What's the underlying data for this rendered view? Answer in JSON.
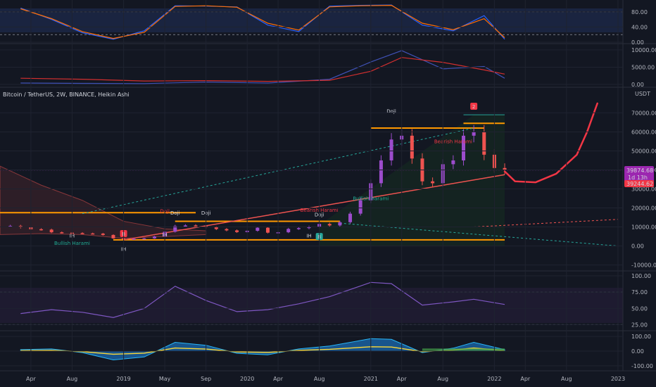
{
  "header": {
    "title": "Bitcoin / TetherUS, 2W, BINANCE, Heikin Ashi",
    "currency": "USDT"
  },
  "colors": {
    "background": "#131722",
    "grid": "#1f2330",
    "up": "#26a69a",
    "up_purple": "#9c4ccc",
    "down": "#ef5350",
    "orange": "#ff9800",
    "red_projection": "#f23645",
    "stoch_k": "#2962ff",
    "stoch_d": "#ff6d00",
    "rsi": "#7e57c2"
  },
  "x_axis": {
    "labels": [
      "Apr",
      "Aug",
      "2019",
      "May",
      "Sep",
      "2020",
      "Apr",
      "Aug",
      "2021",
      "Apr",
      "Aug",
      "2022",
      "Apr",
      "Aug",
      "2023"
    ]
  },
  "price_badges": {
    "current": "39874.68",
    "countdown": "1d 13h",
    "projection": "39244.62"
  },
  "chart_data": [
    {
      "type": "line",
      "panel": "stochastic",
      "ticks": [
        "80.00",
        "40.00",
        "0.00"
      ],
      "ylim": [
        0,
        100
      ],
      "x": [
        "2018-03",
        "2018-06",
        "2018-09",
        "2018-12",
        "2019-03",
        "2019-06",
        "2019-09",
        "2019-12",
        "2020-03",
        "2020-06",
        "2020-09",
        "2020-12",
        "2021-03",
        "2021-06",
        "2021-09",
        "2021-12",
        "2022-02"
      ],
      "series": [
        {
          "values": [
            90,
            60,
            25,
            8,
            30,
            96,
            95,
            93,
            45,
            28,
            95,
            97,
            98,
            45,
            30,
            70,
            8
          ]
        },
        {
          "values": [
            88,
            62,
            28,
            10,
            26,
            94,
            96,
            92,
            50,
            32,
            93,
            96,
            97,
            50,
            33,
            62,
            12
          ]
        }
      ]
    },
    {
      "type": "line",
      "panel": "oscillator",
      "ticks": [
        "10000.00",
        "5000.00",
        "0.00"
      ],
      "ylim": [
        0,
        11000
      ],
      "x": [
        "2018-03",
        "2018-09",
        "2019-03",
        "2019-09",
        "2020-03",
        "2020-09",
        "2021-01",
        "2021-04",
        "2021-08",
        "2021-12",
        "2022-02"
      ],
      "series": [
        {
          "values": [
            400,
            300,
            250,
            700,
            400,
            1500,
            6500,
            9800,
            4500,
            5200,
            1800
          ]
        },
        {
          "values": [
            1800,
            1500,
            1000,
            1100,
            900,
            1200,
            3800,
            7800,
            6400,
            4200,
            3000
          ]
        }
      ]
    },
    {
      "type": "candlestick",
      "panel": "price",
      "title": "Bitcoin / TetherUS, 2W, BINANCE, Heikin Ashi",
      "ticks": [
        "70000.00",
        "60000.00",
        "50000.00",
        "40000.00",
        "30000.00",
        "20000.00",
        "10000.00",
        "0.00",
        "-10000.00"
      ],
      "ylim": [
        -12000,
        82000
      ],
      "candles": [
        {
          "date": "2018-02",
          "value": 10500
        },
        {
          "date": "2018-03",
          "value": 9800
        },
        {
          "date": "2018-04",
          "value": 8800
        },
        {
          "date": "2018-05",
          "value": 8600
        },
        {
          "date": "2018-06",
          "value": 7200
        },
        {
          "date": "2018-07",
          "value": 7000
        },
        {
          "date": "2018-08",
          "value": 6800
        },
        {
          "date": "2018-09",
          "value": 6600
        },
        {
          "date": "2018-10",
          "value": 6500
        },
        {
          "date": "2018-11",
          "value": 5800
        },
        {
          "date": "2018-12",
          "value": 4000
        },
        {
          "date": "2019-01",
          "value": 3700
        },
        {
          "date": "2019-02",
          "value": 3800
        },
        {
          "date": "2019-03",
          "value": 4000
        },
        {
          "date": "2019-04",
          "value": 5000
        },
        {
          "date": "2019-05",
          "value": 7500
        },
        {
          "date": "2019-06",
          "value": 10500
        },
        {
          "date": "2019-07",
          "value": 10800
        },
        {
          "date": "2019-08",
          "value": 10500
        },
        {
          "date": "2019-09",
          "value": 9800
        },
        {
          "date": "2019-10",
          "value": 8900
        },
        {
          "date": "2019-11",
          "value": 8200
        },
        {
          "date": "2019-12",
          "value": 7300
        },
        {
          "date": "2020-01",
          "value": 8000
        },
        {
          "date": "2020-02",
          "value": 9600
        },
        {
          "date": "2020-03",
          "value": 7000
        },
        {
          "date": "2020-04",
          "value": 7200
        },
        {
          "date": "2020-05",
          "value": 9000
        },
        {
          "date": "2020-06",
          "value": 9400
        },
        {
          "date": "2020-07",
          "value": 10000
        },
        {
          "date": "2020-08",
          "value": 11600
        },
        {
          "date": "2020-09",
          "value": 10800
        },
        {
          "date": "2020-10",
          "value": 12500
        },
        {
          "date": "2020-11",
          "value": 17000
        },
        {
          "date": "2020-12",
          "value": 24000
        },
        {
          "date": "2021-01",
          "value": 33000
        },
        {
          "date": "2021-02",
          "value": 45000
        },
        {
          "date": "2021-03",
          "value": 56000
        },
        {
          "date": "2021-04",
          "value": 58000
        },
        {
          "date": "2021-05",
          "value": 46000
        },
        {
          "date": "2021-06",
          "value": 34000
        },
        {
          "date": "2021-07",
          "value": 33000
        },
        {
          "date": "2021-08",
          "value": 43000
        },
        {
          "date": "2021-09",
          "value": 45000
        },
        {
          "date": "2021-10",
          "value": 58000
        },
        {
          "date": "2021-11",
          "value": 60000
        },
        {
          "date": "2021-12",
          "value": 48000
        },
        {
          "date": "2022-01",
          "value": 41000
        },
        {
          "date": "2022-02",
          "value": 39874
        }
      ],
      "projection": {
        "x": [
          "2022-02",
          "2022-03",
          "2022-05",
          "2022-07",
          "2022-09",
          "2022-10",
          "2022-11"
        ],
        "values": [
          39244,
          34000,
          33500,
          38000,
          48000,
          60000,
          75000
        ]
      },
      "annotations": [
        "Doji",
        "Doji",
        "Doji",
        "Doji",
        "Doji",
        "Bearish Harami",
        "Bearish Harami",
        "Bullish Harami",
        "Bullish Harami",
        "IH",
        "IH",
        "IH",
        "IH",
        "2",
        "B",
        "B"
      ]
    },
    {
      "type": "line",
      "panel": "rsi",
      "ticks": [
        "100.00",
        "75.00",
        "50.00",
        "25.00"
      ],
      "ylim": [
        20,
        100
      ],
      "x": [
        "2018-03",
        "2018-06",
        "2018-09",
        "2018-12",
        "2019-03",
        "2019-06",
        "2019-09",
        "2019-12",
        "2020-03",
        "2020-06",
        "2020-09",
        "2021-01",
        "2021-03",
        "2021-06",
        "2021-09",
        "2021-11",
        "2022-02"
      ],
      "values": [
        42,
        48,
        44,
        36,
        50,
        84,
        62,
        45,
        48,
        57,
        68,
        90,
        88,
        55,
        60,
        64,
        56
      ]
    },
    {
      "type": "area",
      "panel": "momentum",
      "ticks": [
        "100.00",
        "0.00",
        "-100.00"
      ],
      "ylim": [
        -120,
        120
      ],
      "x": [
        "2018-03",
        "2018-06",
        "2018-09",
        "2018-12",
        "2019-03",
        "2019-06",
        "2019-09",
        "2019-12",
        "2020-03",
        "2020-06",
        "2020-09",
        "2021-01",
        "2021-03",
        "2021-06",
        "2021-09",
        "2021-11",
        "2022-02"
      ],
      "values": [
        10,
        15,
        -10,
        -60,
        -40,
        60,
        40,
        -15,
        -25,
        15,
        35,
        85,
        80,
        -10,
        20,
        60,
        10
      ]
    }
  ]
}
